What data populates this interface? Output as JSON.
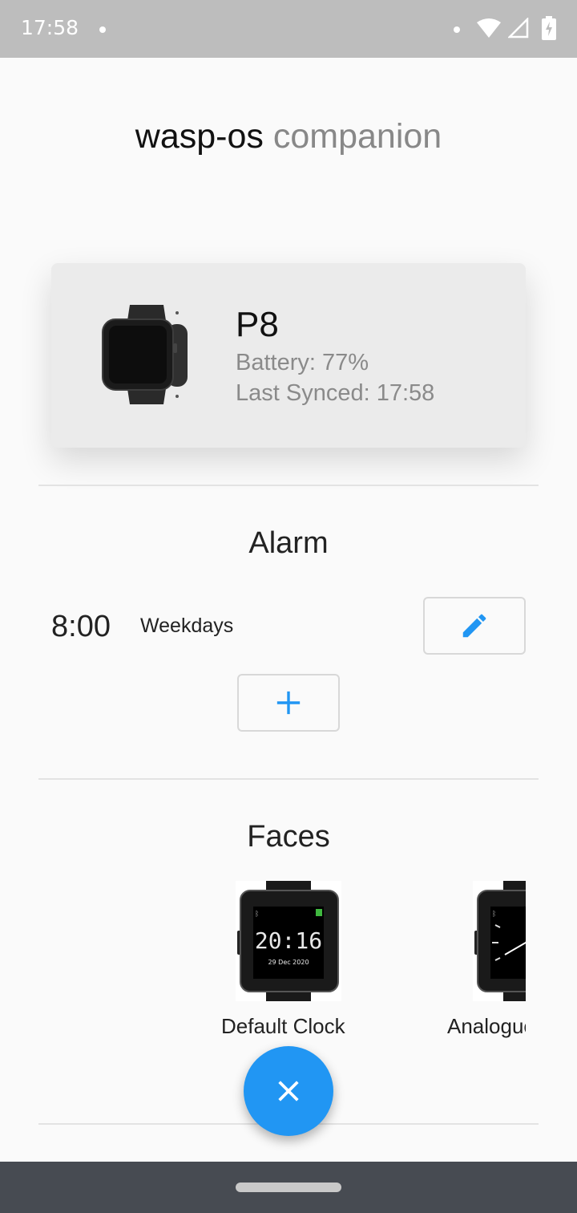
{
  "status_bar": {
    "time": "17:58",
    "icons": [
      "notification-dot-icon",
      "wifi-icon",
      "cell-signal-icon",
      "battery-charging-icon"
    ]
  },
  "app": {
    "title_primary": "wasp-os",
    "title_secondary": "companion"
  },
  "device": {
    "name": "P8",
    "battery": "Battery: 77%",
    "last_synced": "Last Synced: 17:58"
  },
  "alarm": {
    "section_title": "Alarm",
    "items": [
      {
        "time": "8:00",
        "days": "Weekdays"
      }
    ],
    "edit_icon": "pencil-icon",
    "add_icon": "plus-icon"
  },
  "faces": {
    "section_title": "Faces",
    "items": [
      {
        "label": "Default Clock",
        "preview_time": "20:16",
        "preview_date": "29 Dec 2020"
      },
      {
        "label": "Analogue"
      }
    ]
  },
  "fab": {
    "icon": "close-icon"
  },
  "colors": {
    "accent": "#2196f3",
    "status_bar": "#bdbdbd",
    "nav_bar": "#474b52",
    "card": "#ebebeb",
    "title_secondary": "#888888"
  }
}
